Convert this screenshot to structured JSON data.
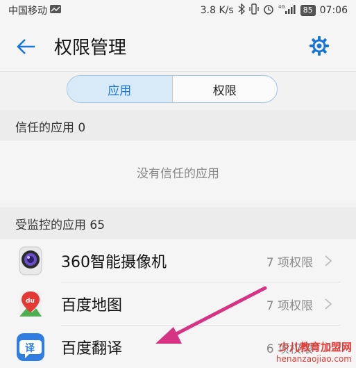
{
  "status_bar": {
    "carrier": "中国移动",
    "speed": "3.8 K/s",
    "battery": "85",
    "time": "07:06"
  },
  "header": {
    "title": "权限管理",
    "back_icon": "back-arrow-icon",
    "settings_icon": "gear-icon"
  },
  "tabs": [
    {
      "label": "应用",
      "active": true
    },
    {
      "label": "权限",
      "active": false
    }
  ],
  "trusted_section": {
    "title": "信任的应用 0",
    "empty_text": "没有信任的应用"
  },
  "monitored_section": {
    "title": "受监控的应用 65"
  },
  "apps": [
    {
      "name": "360智能摄像机",
      "permissions": "7 项权限"
    },
    {
      "name": "百度地图",
      "permissions": "7 项权限"
    },
    {
      "name": "百度翻译",
      "permissions": "6 项权限"
    }
  ],
  "colors": {
    "accent": "#1976d2",
    "annotation_arrow": "#d63384",
    "watermark": "#e53935"
  },
  "watermark": {
    "line1": "少儿教育加盟网",
    "line2": "henanzaojiao.com"
  }
}
